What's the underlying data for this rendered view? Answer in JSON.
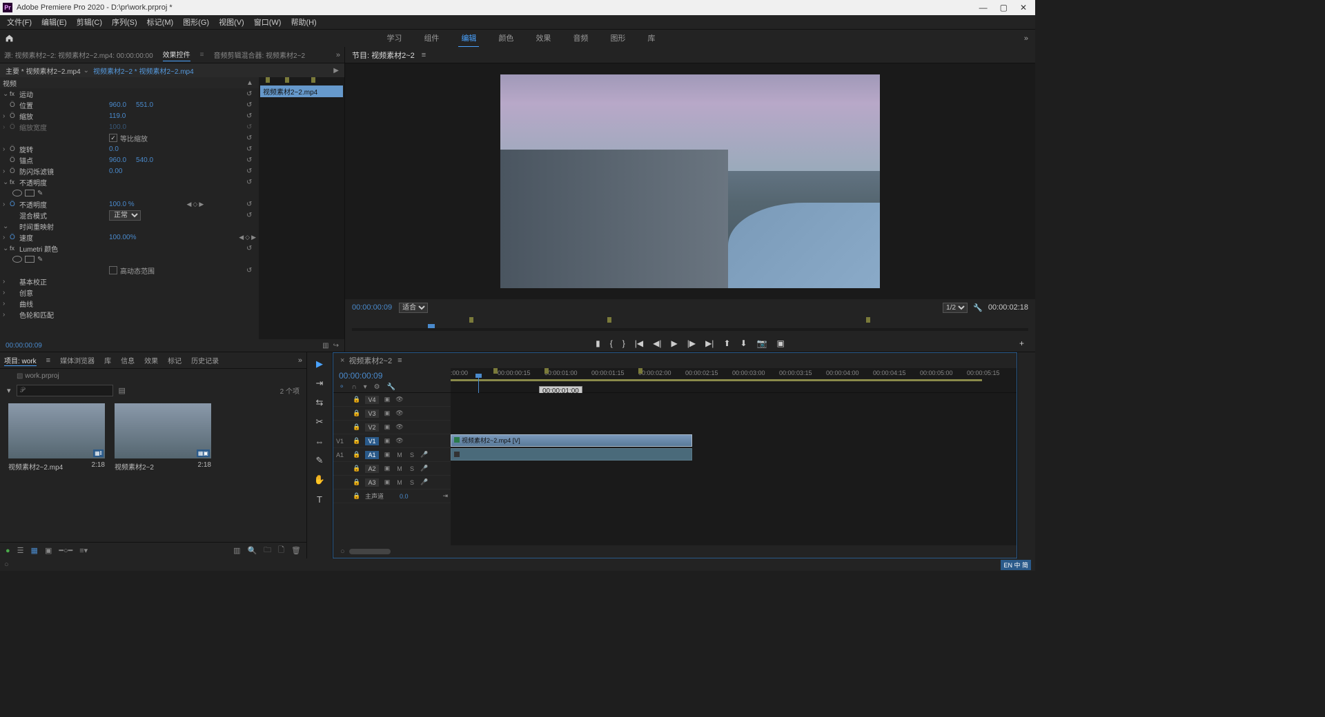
{
  "app": {
    "name": "Pr",
    "title": "Adobe Premiere Pro 2020 - D:\\pr\\work.prproj *"
  },
  "menu": [
    "文件(F)",
    "编辑(E)",
    "剪辑(C)",
    "序列(S)",
    "标记(M)",
    "图形(G)",
    "视图(V)",
    "窗口(W)",
    "帮助(H)"
  ],
  "workspaces": [
    "学习",
    "组件",
    "编辑",
    "颜色",
    "效果",
    "音频",
    "图形",
    "库"
  ],
  "source_tab": "源: 视频素材2~2: 视频素材2~2.mp4: 00:00:00:00",
  "effect_tab": "效果控件",
  "audiomix_tab": "音频剪辑混合器: 视频素材2~2",
  "effect_header": {
    "main": "主要 * 视频素材2~2.mp4",
    "sub": "视频素材2~2 * 视频素材2~2.mp4"
  },
  "clip_label": "视频素材2~2.mp4",
  "props": {
    "video": "视频",
    "motion": "运动",
    "position": "位置",
    "pos_x": "960.0",
    "pos_y": "551.0",
    "scale": "缩放",
    "scale_val": "119.0",
    "scale_w": "缩放宽度",
    "scale_w_val": "100.0",
    "uniform": "等比缩放",
    "rotation": "旋转",
    "rot_val": "0.0",
    "anchor": "锚点",
    "anchor_x": "960.0",
    "anchor_y": "540.0",
    "antiflicker": "防闪烁滤镜",
    "antiflicker_val": "0.00",
    "opacity_sec": "不透明度",
    "opacity": "不透明度",
    "opacity_val": "100.0 %",
    "blend": "混合模式",
    "blend_val": "正常",
    "timeremap": "时间重映射",
    "speed": "速度",
    "speed_val": "100.00%",
    "lumetri": "Lumetri 颜色",
    "hdr": "高动态范围",
    "basic": "基本校正",
    "creative": "创意",
    "curve": "曲线",
    "colorwheel": "色轮和匹配"
  },
  "tc_left": "00:00:00:09",
  "program": {
    "tab": "节目: 视频素材2~2",
    "tc": "00:00:00:09",
    "fit": "适合",
    "zoom": "1/2",
    "dur": "00:00:02:18"
  },
  "project": {
    "tabs": [
      "项目: work",
      "媒体浏览器",
      "库",
      "信息",
      "效果",
      "标记",
      "历史记录"
    ],
    "file": "work.prproj",
    "count": "2 个项",
    "items": [
      {
        "name": "视频素材2~2.mp4",
        "dur": "2:18"
      },
      {
        "name": "视频素材2~2",
        "dur": "2:18"
      }
    ]
  },
  "timeline": {
    "tab": "视频素材2~2",
    "tc": "00:00:00:09",
    "ruler": [
      ":00:00",
      "00:00:00:15",
      "00:00:01:00",
      "00:00:01:15",
      "00:00:02:00",
      "00:00:02:15",
      "00:00:03:00",
      "00:00:03:15",
      "00:00:04:00",
      "00:00:04:15",
      "00:00:05:00",
      "00:00:05:15"
    ],
    "tooltip": "00:00:01:00",
    "v": [
      "V4",
      "V3",
      "V2",
      "V1"
    ],
    "a": [
      "A1",
      "A2",
      "A3"
    ],
    "src_v": "V1",
    "src_a": "A1",
    "master": "主声道",
    "master_val": "0.0",
    "clip_name": "视频素材2~2.mp4 [V]"
  },
  "ime": "EN 中 简"
}
